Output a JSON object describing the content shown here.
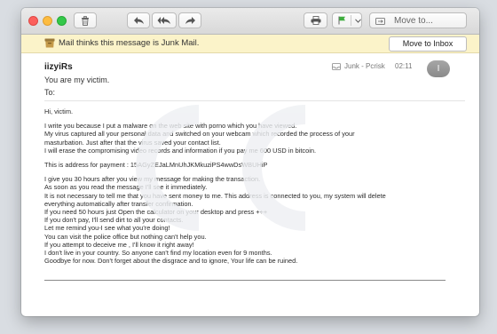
{
  "toolbar": {
    "move_to_label": "Move to..."
  },
  "junk_banner": {
    "text": "Mail thinks this message is Junk Mail.",
    "button_label": "Move to Inbox"
  },
  "header": {
    "sender": "iizyiRs",
    "subject": "You are my  victim.",
    "to_label": "To:",
    "mailbox": "Junk - Pcrisk",
    "time": "02:11",
    "avatar_initial": "I"
  },
  "message": {
    "greeting": "Hi, victim.",
    "para1": [
      "I write you because I put a malware on the web site with porno which you have viewed.",
      "My virus captured all your personal data and switched on your webcam which recorded the process of your",
      "masturbation. Just after that the virus saved your contact list.",
      "I will erase the compromising video records and information if you pay me 600 USD in bitcoin."
    ],
    "address_line": "This is address for payment : 15AGyZEJaLMnUhJKMkuziPS4wwDsWBUHiP",
    "para3": [
      "I give you 30 hours after you view my message for making the transaction.",
      "As soon as you read the message I'll see it immediately.",
      "It is not necessary to tell me that you have sent money to me. This address is connected to you, my system will delete",
      "everything automatically after transfer confirmation.",
      "If you need 50 hours just Open the calculator on your desktop and press +++",
      "If you don't pay, I'll send dirt to all your contacts.",
      "Let me remind you-I see what you're doing!",
      "You can visit the police office but nothing can't help you.",
      "If you attempt to deceive me , I'll know it right away!",
      "I don't live in your country. So anyone can't find my location even for 9 months.",
      "Goodbye for now. Don't forget about the disgrace and to ignore, Your life can be ruined."
    ]
  },
  "colors": {
    "junk_banner_bg": "#fbf3c9",
    "flag_green": "#3fae3f",
    "avatar_gray": "#9a9a9a"
  },
  "icons": [
    "trash-icon",
    "reply-icon",
    "reply-all-icon",
    "forward-icon",
    "print-icon",
    "flag-icon",
    "chevron-down-icon",
    "mailbox-icon",
    "junk-mail-icon",
    "folder-icon"
  ]
}
